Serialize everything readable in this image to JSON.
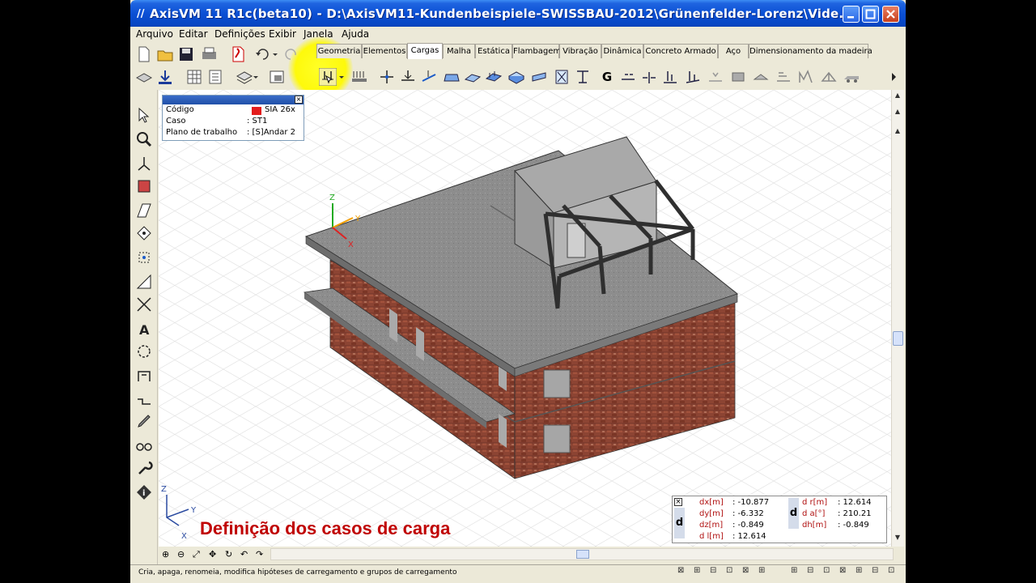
{
  "window": {
    "title": "AxisVM 11 R1c(beta10) - D:\\AxisVM11-Kundenbeispiele-SWISSBAU-2012\\Grünenfelder-Lorenz\\Vide..."
  },
  "menu": [
    "Arquivo",
    "Editar",
    "Definições",
    "Exibir",
    "Janela",
    "Ajuda"
  ],
  "tabs": [
    "Geometria",
    "Elementos",
    "Cargas",
    "Malha",
    "Estática",
    "Flambagem",
    "Vibração",
    "Dinâmica",
    "Concreto Armado",
    "Aço",
    "Dimensionamento da madeira"
  ],
  "active_tab": "Cargas",
  "info_panel": {
    "rows": [
      {
        "label": "Código",
        "value": "SIA 26x"
      },
      {
        "label": "Caso",
        "value": ": ST1"
      },
      {
        "label": "Plano de trabalho",
        "value": ": [S]Andar 2"
      }
    ]
  },
  "coords": {
    "left": [
      {
        "label": "dx[m]",
        "value": ": -10.877"
      },
      {
        "label": "dy[m]",
        "value": ": -6.332"
      },
      {
        "label": "dz[m]",
        "value": ": -0.849"
      },
      {
        "label": "d l[m]",
        "value": ": 12.614"
      }
    ],
    "right": [
      {
        "label": "d r[m]",
        "value": ": 12.614"
      },
      {
        "label": "d  a[°]",
        "value": ": 210.21"
      },
      {
        "label": "dh[m]",
        "value": ": -0.849"
      }
    ],
    "d_label": "d"
  },
  "axes": {
    "x": "X",
    "y": "Y",
    "z": "Z"
  },
  "caption": "Definição dos casos de carga",
  "status": "Cria, apaga, renomeia, modifica hipóteses de carregamento e grupos de carregamento",
  "toolbar_misc": {
    "g_label": "G"
  },
  "colors": {
    "caption": "#c00000",
    "titlebar": "#0a4fd4",
    "brick": "#8a3f2c",
    "slab": "#8a8a8a"
  }
}
